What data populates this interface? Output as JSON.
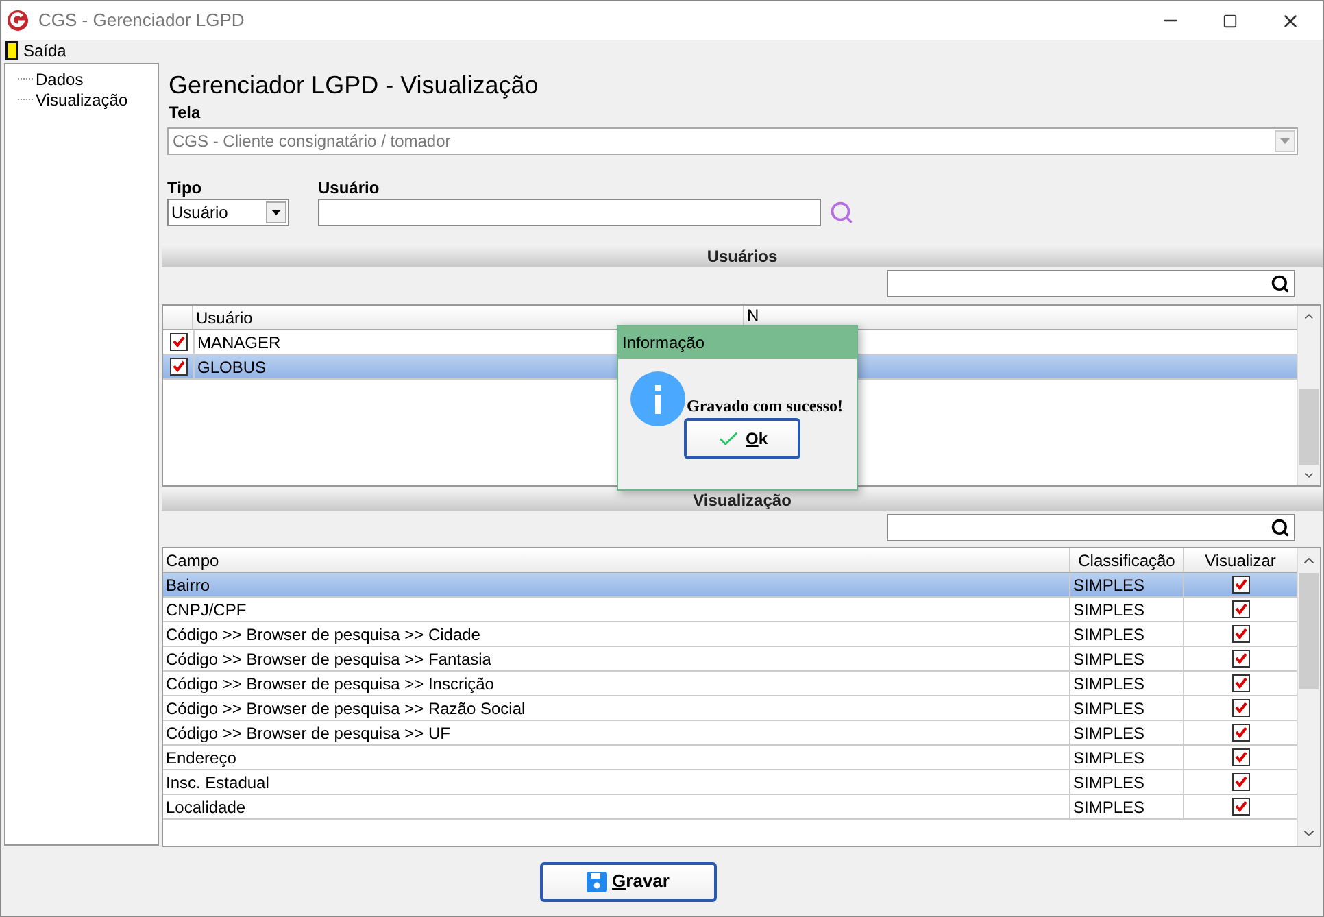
{
  "window": {
    "title": "CGS - Gerenciador LGPD"
  },
  "menu": [
    {
      "label": "Saída"
    }
  ],
  "sidebar": {
    "items": [
      {
        "label": "Dados"
      },
      {
        "label": "Visualização"
      }
    ]
  },
  "page_title": "Gerenciador LGPD - Visualização",
  "tela": {
    "label": "Tela",
    "value": "CGS - Cliente consignatário / tomador"
  },
  "tipo": {
    "label": "Tipo",
    "value": "Usuário"
  },
  "usuario": {
    "label": "Usuário"
  },
  "users_section": {
    "title": "Usuários",
    "columns": [
      "Usuário",
      "N"
    ],
    "rows": [
      {
        "name": "MANAGER",
        "checked": true,
        "selected": false
      },
      {
        "name": "GLOBUS",
        "checked": true,
        "selected": true
      }
    ]
  },
  "fields_section": {
    "title": "Visualização",
    "columns": [
      "Campo",
      "Classificação",
      "Visualizar"
    ],
    "rows": [
      {
        "campo": "Bairro",
        "classificacao": "SIMPLES",
        "visualizar": true,
        "selected": true
      },
      {
        "campo": "CNPJ/CPF",
        "classificacao": "SIMPLES",
        "visualizar": true,
        "selected": false
      },
      {
        "campo": "Código >> Browser de pesquisa >> Cidade",
        "classificacao": "SIMPLES",
        "visualizar": true,
        "selected": false
      },
      {
        "campo": "Código >> Browser de pesquisa >> Fantasia",
        "classificacao": "SIMPLES",
        "visualizar": true,
        "selected": false
      },
      {
        "campo": "Código >> Browser de pesquisa >> Inscrição",
        "classificacao": "SIMPLES",
        "visualizar": true,
        "selected": false
      },
      {
        "campo": "Código >> Browser de pesquisa >> Razão Social",
        "classificacao": "SIMPLES",
        "visualizar": true,
        "selected": false
      },
      {
        "campo": "Código >> Browser de pesquisa >> UF",
        "classificacao": "SIMPLES",
        "visualizar": true,
        "selected": false
      },
      {
        "campo": "Endereço",
        "classificacao": "SIMPLES",
        "visualizar": true,
        "selected": false
      },
      {
        "campo": "Insc. Estadual",
        "classificacao": "SIMPLES",
        "visualizar": true,
        "selected": false
      },
      {
        "campo": "Localidade",
        "classificacao": "SIMPLES",
        "visualizar": true,
        "selected": false
      }
    ]
  },
  "dialog": {
    "title": "Informação",
    "message": "Gravado com sucesso!",
    "button": "Ok"
  },
  "save_button": "Gravar"
}
